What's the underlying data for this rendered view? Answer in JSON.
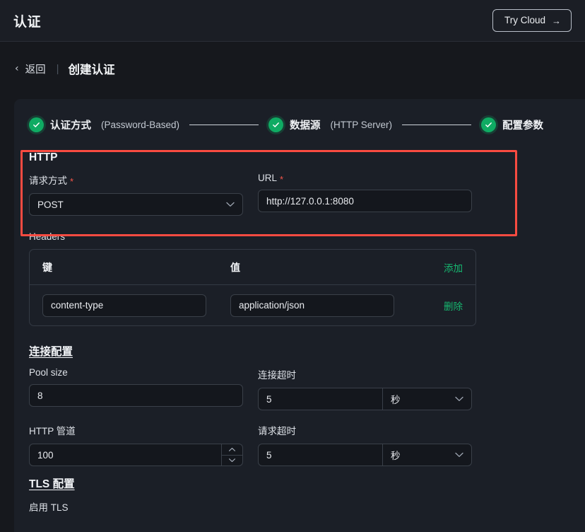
{
  "header": {
    "app_title": "认证",
    "try_cloud_label": "Try Cloud",
    "try_cloud_arrow": "→"
  },
  "breadcrumb": {
    "back_icon": "‹",
    "back_label": "返回",
    "separator": "|",
    "current": "创建认证"
  },
  "stepper": {
    "steps": [
      {
        "name": "认证方式",
        "sub": "(Password-Based)",
        "state": "done"
      },
      {
        "name": "数据源",
        "sub": "(HTTP Server)",
        "state": "done"
      },
      {
        "name": "配置参数",
        "sub": "",
        "state": "done"
      }
    ]
  },
  "http_section": {
    "title": "HTTP",
    "method": {
      "label": "请求方式",
      "required": "*",
      "value": "POST",
      "chevron": "⌄"
    },
    "url": {
      "label": "URL",
      "required": "*",
      "value": "http://127.0.0.1:8080"
    }
  },
  "headers_section": {
    "title": "Headers",
    "columns": [
      "键",
      "值"
    ],
    "add_label": "添加",
    "rows": [
      {
        "key": "content-type",
        "value": "application/json",
        "delete_label": "删除"
      }
    ]
  },
  "connection_section": {
    "title": "连接配置",
    "pool_size": {
      "label": "Pool size",
      "value": "8"
    },
    "connect_timeout": {
      "label": "连接超时",
      "value": "5",
      "unit": "秒",
      "chevron": "⌄"
    },
    "http_pipeline": {
      "label": "HTTP 管道",
      "value": "100",
      "up": "⌃",
      "down": "⌄"
    },
    "request_timeout": {
      "label": "请求超时",
      "value": "5",
      "unit": "秒",
      "chevron": "⌄"
    }
  },
  "tls_section": {
    "title": "TLS 配置",
    "enable_label": "启用 TLS"
  },
  "colors": {
    "accent_green": "#0fab63",
    "link_green": "#16b870",
    "required_red": "#f5564a",
    "highlight_red": "#fa4b41",
    "page_bg": "#16181d",
    "card_bg": "#1b1f27",
    "input_bg": "#14171d"
  }
}
